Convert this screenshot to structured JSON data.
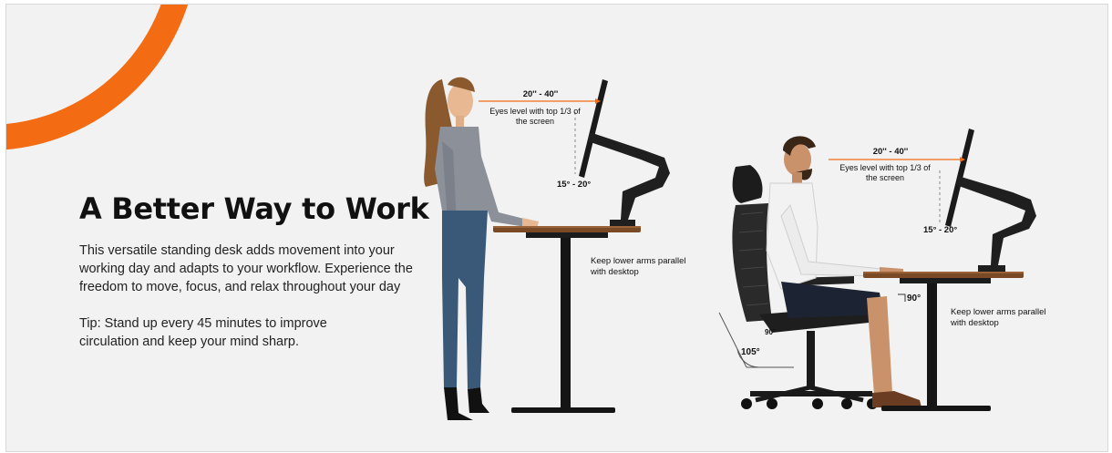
{
  "banner": {
    "title": "A Better Way to Work",
    "description": "This versatile standing desk adds movement into your working day and adapts to your workflow. Experience the freedom to move, focus, and relax throughout your day",
    "tip": "Tip: Stand up every 45 minutes to improve circulation and keep your mind sharp.",
    "accent_color": "#f36b12"
  },
  "standing": {
    "distance": "20'' - 40''",
    "eye_level_line1": "Eyes level with top 1/3 of",
    "eye_level_line2": "the screen",
    "tilt": "15° - 20°",
    "arms_line1": "Keep lower arms parallel",
    "arms_line2": "with desktop"
  },
  "sitting": {
    "distance": "20'' - 40''",
    "eye_level_line1": "Eyes level with top 1/3 of",
    "eye_level_line2": "the screen",
    "tilt": "15° - 20°",
    "arms_line1": "Keep lower arms parallel",
    "arms_line2": "with desktop",
    "knee_angle": "90°",
    "hip_angle": "90°",
    "recline_angle": "105°"
  }
}
